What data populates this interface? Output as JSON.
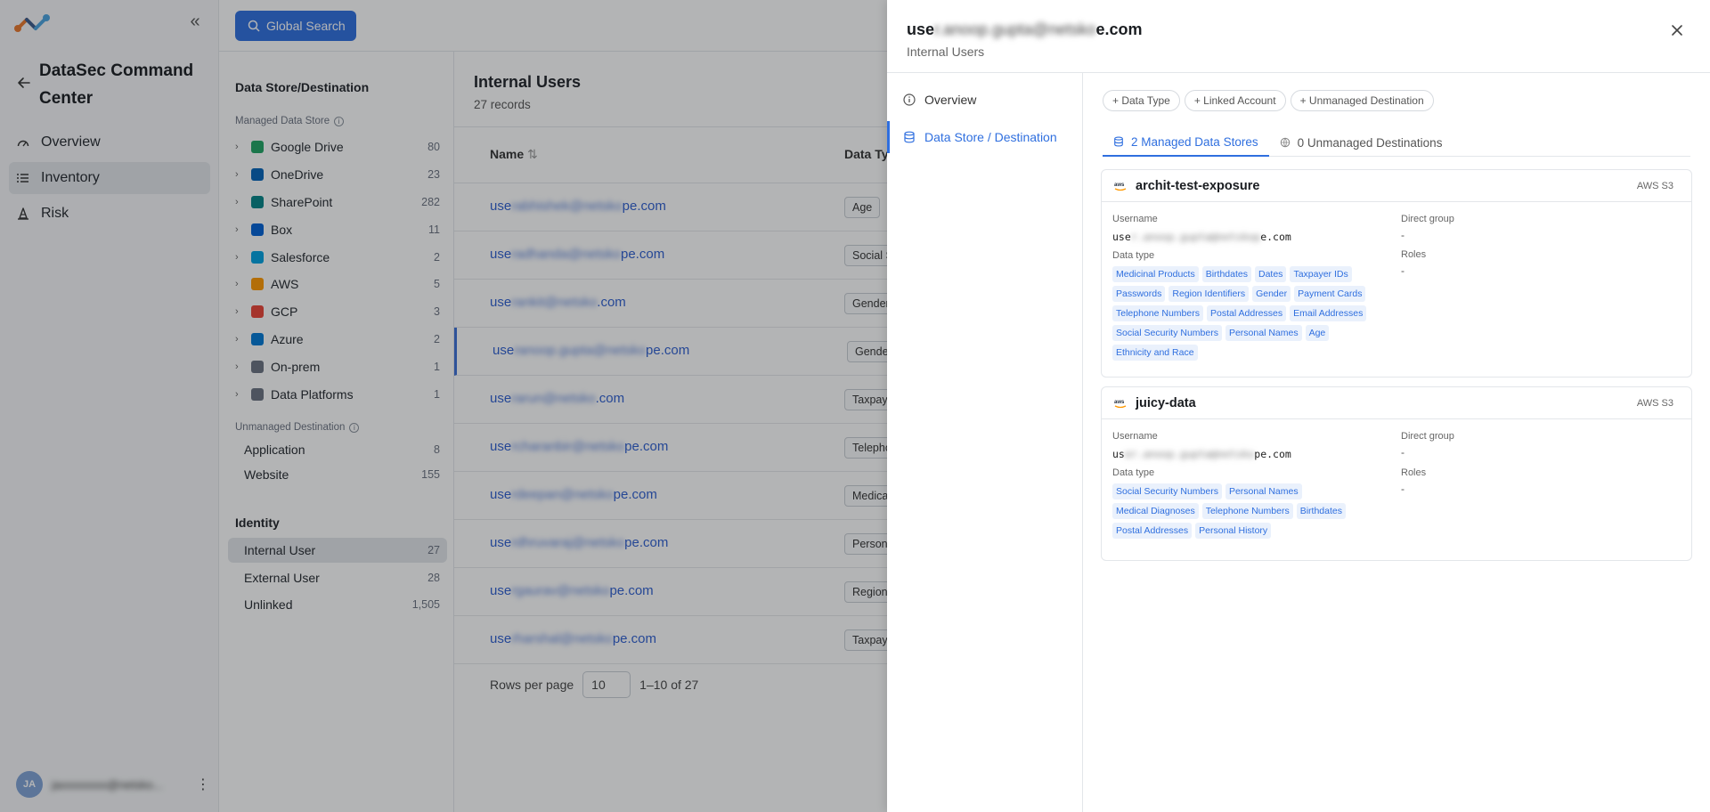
{
  "app": {
    "title": "DataSec Command Center"
  },
  "nav": [
    {
      "label": "Overview",
      "icon": "gauge-icon"
    },
    {
      "label": "Inventory",
      "icon": "list-icon"
    },
    {
      "label": "Risk",
      "icon": "cone-icon"
    }
  ],
  "user": {
    "initials": "JA",
    "name": "jaxxxxxxxx@netsko..."
  },
  "topbar": {
    "search_label": "Global Search"
  },
  "filters": {
    "section_title": "Data Store/Destination",
    "managed_title": "Managed Data Store",
    "managed": [
      {
        "label": "Google Drive",
        "count": "80",
        "icon": "google-drive-icon",
        "color": "#1fa463"
      },
      {
        "label": "OneDrive",
        "count": "23",
        "icon": "onedrive-icon",
        "color": "#0364b8"
      },
      {
        "label": "SharePoint",
        "count": "282",
        "icon": "sharepoint-icon",
        "color": "#038387"
      },
      {
        "label": "Box",
        "count": "11",
        "icon": "box-icon",
        "color": "#0061d5"
      },
      {
        "label": "Salesforce",
        "count": "2",
        "icon": "salesforce-icon",
        "color": "#00a1e0"
      },
      {
        "label": "AWS",
        "count": "5",
        "icon": "aws-icon",
        "color": "#ff9900"
      },
      {
        "label": "GCP",
        "count": "3",
        "icon": "gcp-icon",
        "color": "#ea4335"
      },
      {
        "label": "Azure",
        "count": "2",
        "icon": "azure-icon",
        "color": "#0078d4"
      },
      {
        "label": "On-prem",
        "count": "1",
        "icon": "server-icon",
        "color": "#6b7280"
      },
      {
        "label": "Data Platforms",
        "count": "1",
        "icon": "database-icon",
        "color": "#6b7280"
      }
    ],
    "unmanaged_title": "Unmanaged Destination",
    "unmanaged": [
      {
        "label": "Application",
        "count": "8"
      },
      {
        "label": "Website",
        "count": "155"
      }
    ],
    "identity_title": "Identity",
    "identity": [
      {
        "label": "Internal User",
        "count": "27"
      },
      {
        "label": "External User",
        "count": "28"
      },
      {
        "label": "Unlinked",
        "count": "1,505"
      }
    ]
  },
  "table": {
    "title": "Internal Users",
    "subtitle": "27 records",
    "col_name": "Name",
    "col_dtype": "Data Ty",
    "rows": [
      {
        "pre": "use",
        "hidden": "rabhishek@netsko",
        "post": "pe.com",
        "chip": "Age"
      },
      {
        "pre": "use",
        "hidden": "radhanda@netsko",
        "post": "pe.com",
        "chip": "Social S"
      },
      {
        "pre": "use",
        "hidden": "rankit@netsko",
        "post": ".com",
        "chip": "Gender"
      },
      {
        "pre": "use",
        "hidden": "ranoop.gupta@netsko",
        "post": "pe.com",
        "chip": "Gender"
      },
      {
        "pre": "use",
        "hidden": "rarun@netsko",
        "post": ".com",
        "chip": "Taxpay"
      },
      {
        "pre": "use",
        "hidden": "rcharanbir@netsko",
        "post": "pe.com",
        "chip": "Telepho"
      },
      {
        "pre": "use",
        "hidden": "rdeepan@netsko",
        "post": "pe.com",
        "chip": "Medica"
      },
      {
        "pre": "use",
        "hidden": "rdhruvaraj@netsko",
        "post": "pe.com",
        "chip": "Person"
      },
      {
        "pre": "use",
        "hidden": "rgaurav@netsko",
        "post": "pe.com",
        "chip": "Region"
      },
      {
        "pre": "use",
        "hidden": "rharshal@netsko",
        "post": "pe.com",
        "chip": "Taxpay"
      }
    ],
    "rows_per_page_label": "Rows per page",
    "rows_per_page": "10",
    "range": "1–10 of 27"
  },
  "drawer": {
    "title_pre": "use",
    "title_hidden": "r.anoop.gupta@netsko",
    "title_post": "e.com",
    "subtitle": "Internal Users",
    "nav": [
      {
        "label": "Overview",
        "icon": "info-icon"
      },
      {
        "label": "Data Store / Destination",
        "icon": "database-icon"
      }
    ],
    "chips": [
      "+ Data Type",
      "+ Linked Account",
      "+ Unmanaged Destination"
    ],
    "tabs": [
      {
        "label": "2 Managed Data Stores",
        "icon": "database-icon"
      },
      {
        "label": "0 Unmanaged Destinations",
        "icon": "globe-icon"
      }
    ],
    "username_label": "Username",
    "direct_group_label": "Direct group",
    "data_type_label": "Data type",
    "roles_label": "Roles",
    "dash": "-",
    "cards": [
      {
        "name": "archit-test-exposure",
        "type": "AWS S3",
        "username_pre": "use",
        "username_hidden": "r.anoop.gupta@netskop",
        "username_post": "e.com",
        "data_types": [
          "Medicinal Products",
          "Birthdates",
          "Dates",
          "Taxpayer IDs",
          "Passwords",
          "Region Identifiers",
          "Gender",
          "Payment Cards",
          "Telephone Numbers",
          "Postal Addresses",
          "Email Addresses",
          "Social Security Numbers",
          "Personal Names",
          "Age",
          "Ethnicity and Race"
        ]
      },
      {
        "name": "juicy-data",
        "type": "AWS S3",
        "username_pre": "us",
        "username_hidden": "er.anoop.gupta@netsko",
        "username_post": "pe.com",
        "data_types": [
          "Social Security Numbers",
          "Personal Names",
          "Medical Diagnoses",
          "Telephone Numbers",
          "Birthdates",
          "Postal Addresses",
          "Personal History"
        ]
      }
    ]
  },
  "colors": {
    "accent": "#2f6fdf",
    "link": "#2f5fd0",
    "tag_bg": "#eaf1fc"
  }
}
